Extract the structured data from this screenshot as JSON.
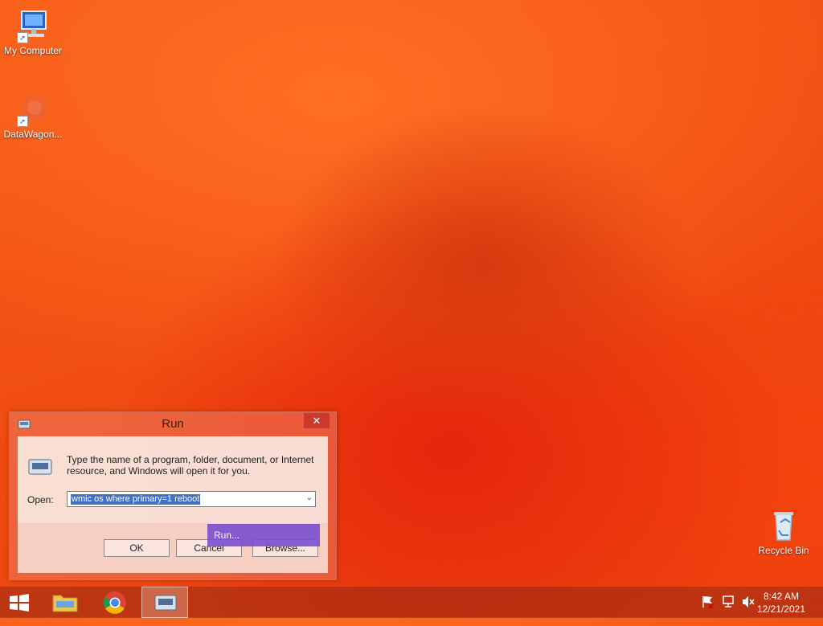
{
  "desktop": {
    "icons": [
      {
        "label": "My Computer"
      },
      {
        "label": "DataWagon..."
      },
      {
        "label": "Recycle Bin"
      }
    ]
  },
  "run_dialog": {
    "title": "Run",
    "close_glyph": "✕",
    "description": "Type the name of a program, folder, document, or Internet resource, and Windows will open it for you.",
    "open_label": "Open:",
    "open_value": "wmic os where primary=1 reboot",
    "buttons": {
      "ok": "OK",
      "cancel": "Cancel",
      "browse": "Browse..."
    }
  },
  "tooltip": {
    "text": "Run..."
  },
  "taskbar": {
    "items": [
      "start-icon",
      "file-explorer-icon",
      "chrome-icon",
      "run-app-icon"
    ],
    "clock": {
      "time": "8:42 AM",
      "date": "12/21/2021"
    }
  }
}
